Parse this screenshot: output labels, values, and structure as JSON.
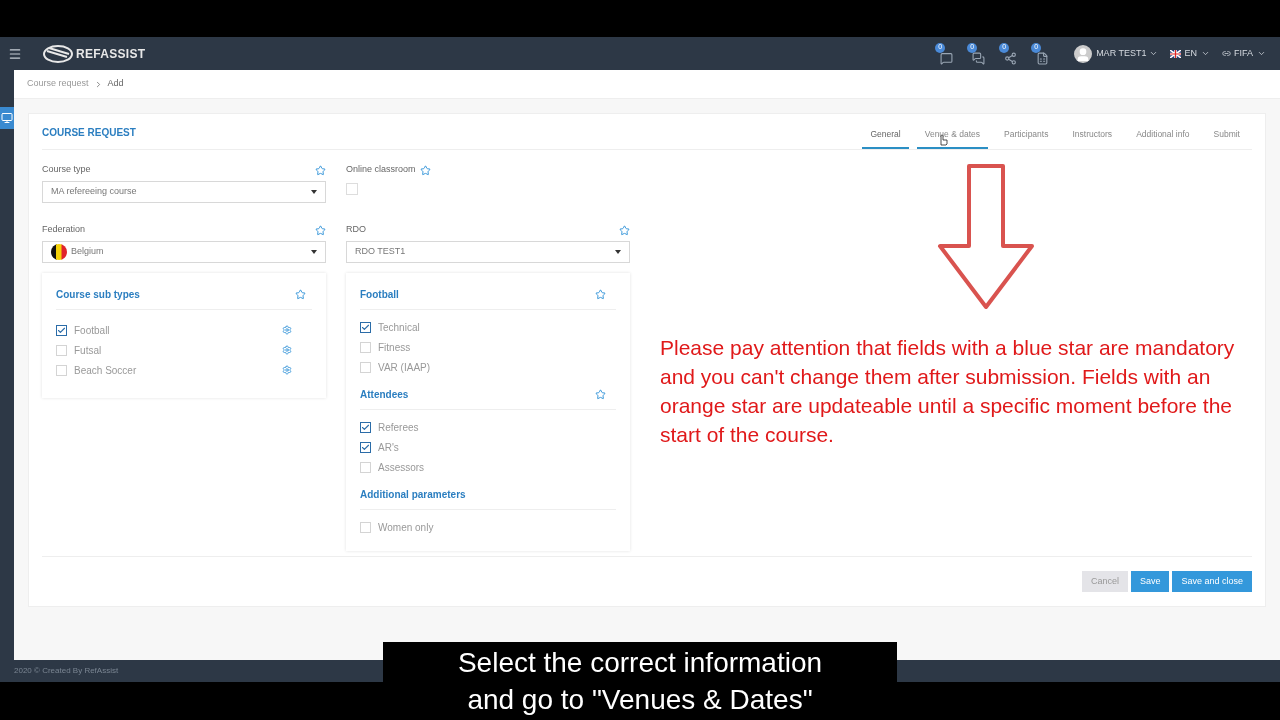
{
  "navbar": {
    "brand": "REFASSIST",
    "notifications": [
      {
        "count": "0",
        "kind": "message"
      },
      {
        "count": "0",
        "kind": "chat"
      },
      {
        "count": "0",
        "kind": "share"
      },
      {
        "count": "0",
        "kind": "excel"
      }
    ],
    "user": "MAR TEST1",
    "language": "EN",
    "organisation": "FIFA"
  },
  "breadcrumb": [
    "Course request",
    "Add"
  ],
  "card": {
    "title": "COURSE REQUEST",
    "tabs": [
      {
        "label": "General",
        "selected": true,
        "hovered": false
      },
      {
        "label": "Venue & dates",
        "selected": false,
        "hovered": true
      },
      {
        "label": "Participants",
        "selected": false,
        "hovered": false
      },
      {
        "label": "Instructors",
        "selected": false,
        "hovered": false
      },
      {
        "label": "Additional info",
        "selected": false,
        "hovered": false
      },
      {
        "label": "Submit",
        "selected": false,
        "hovered": false
      }
    ],
    "course_type": {
      "label": "Course type",
      "value": "MA refereeing course"
    },
    "online_classroom": {
      "label": "Online classroom",
      "checked": false
    },
    "federation": {
      "label": "Federation",
      "value": "Belgium"
    },
    "rdo": {
      "label": "RDO",
      "value": "RDO TEST1"
    },
    "sub_types": {
      "title": "Course sub types",
      "items": [
        {
          "label": "Football",
          "checked": true
        },
        {
          "label": "Futsal",
          "checked": false
        },
        {
          "label": "Beach Soccer",
          "checked": false
        }
      ]
    },
    "sections": [
      {
        "title": "Football",
        "starred": true,
        "items": [
          {
            "label": "Technical",
            "checked": true
          },
          {
            "label": "Fitness",
            "checked": false
          },
          {
            "label": "VAR (IAAP)",
            "checked": false
          }
        ]
      },
      {
        "title": "Attendees",
        "starred": true,
        "items": [
          {
            "label": "Referees",
            "checked": true
          },
          {
            "label": "AR's",
            "checked": true
          },
          {
            "label": "Assessors",
            "checked": false
          }
        ]
      },
      {
        "title": "Additional parameters",
        "starred": false,
        "items": [
          {
            "label": "Women only",
            "checked": false
          }
        ]
      }
    ],
    "buttons": [
      {
        "label": "Cancel",
        "kind": "secondary"
      },
      {
        "label": "Save",
        "kind": "primary"
      },
      {
        "label": "Save and close",
        "kind": "primary"
      }
    ]
  },
  "annotation": "Please pay attention that fields with a blue star are mandatory and you can't change them after submission. Fields with an orange star are updateable until a specific moment before the start of the course.",
  "footer": "2020 © Created By RefAssist",
  "caption": [
    "Select the correct information",
    "and go to \"Venues & Dates\""
  ]
}
